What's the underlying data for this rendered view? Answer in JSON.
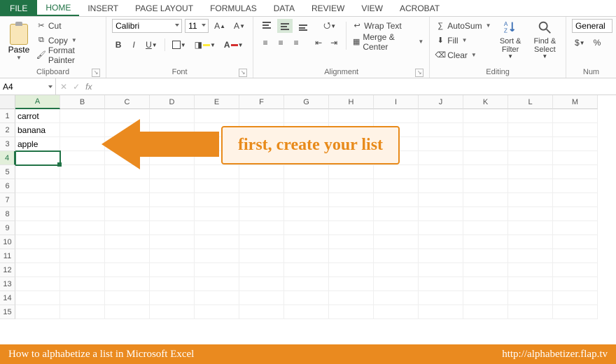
{
  "tabs": {
    "file": "FILE",
    "list": [
      "HOME",
      "INSERT",
      "PAGE LAYOUT",
      "FORMULAS",
      "DATA",
      "REVIEW",
      "VIEW",
      "ACROBAT"
    ],
    "active": 0
  },
  "clipboard": {
    "paste": "Paste",
    "cut": "Cut",
    "copy": "Copy",
    "fmt": "Format Painter",
    "group": "Clipboard"
  },
  "font": {
    "name": "Calibri",
    "size": "11",
    "group": "Font"
  },
  "alignment": {
    "wrap": "Wrap Text",
    "merge": "Merge & Center",
    "group": "Alignment"
  },
  "editing": {
    "autosum": "AutoSum",
    "fill": "Fill",
    "clear": "Clear",
    "sort": "Sort & Filter",
    "find": "Find & Select",
    "group": "Editing"
  },
  "number": {
    "format": "General",
    "group": "Num"
  },
  "fx": {
    "cellref": "A4",
    "fx": "fx",
    "value": ""
  },
  "columns": [
    "A",
    "B",
    "C",
    "D",
    "E",
    "F",
    "G",
    "H",
    "I",
    "J",
    "K",
    "L",
    "M"
  ],
  "rows": [
    1,
    2,
    3,
    4,
    5,
    6,
    7,
    8,
    9,
    10,
    11,
    12,
    13,
    14,
    15
  ],
  "cells": {
    "A1": "carrot",
    "A2": "banana",
    "A3": "apple"
  },
  "activeCell": "A4",
  "annotation": "first, create your list",
  "footer": {
    "left": "How to alphabetize a list in Microsoft Excel",
    "right": "http://alphabetizer.flap.tv"
  }
}
